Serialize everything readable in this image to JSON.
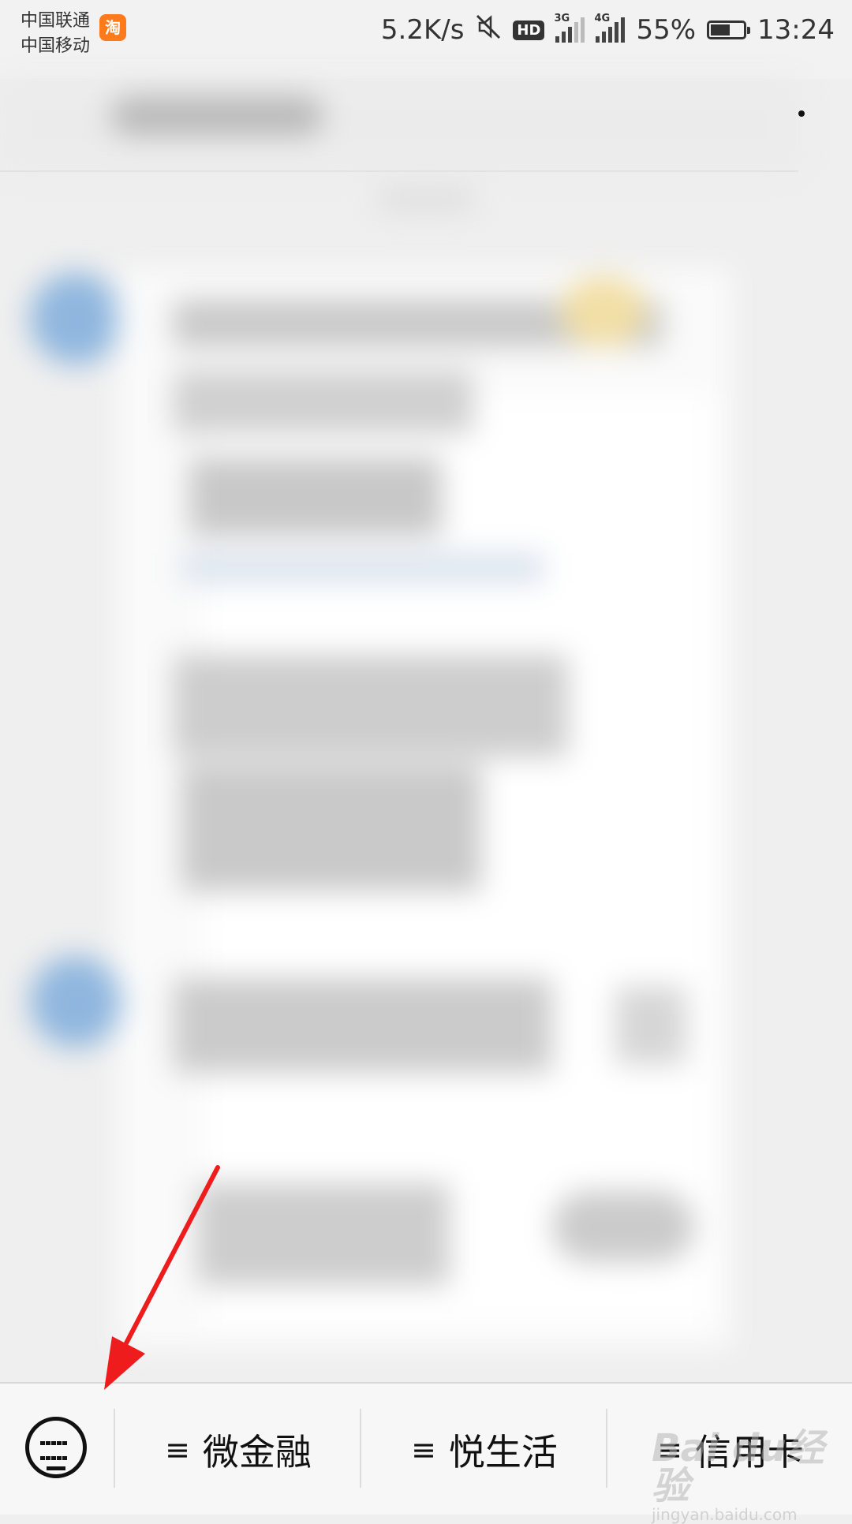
{
  "status_bar": {
    "carrier_1": "中国联通",
    "carrier_2": "中国移动",
    "app_icon_label": "淘",
    "net_speed": "5.2K/s",
    "hd": "HD",
    "signal_1_type": "3G",
    "signal_2_type": "4G",
    "battery": "55%",
    "battery_level": 0.55,
    "time": "13:24"
  },
  "bottom_menu": {
    "menu_glyph": "≡",
    "tabs": [
      {
        "label": "微金融"
      },
      {
        "label": "悦生活"
      },
      {
        "label": "信用卡"
      }
    ]
  },
  "colors": {
    "arrow": "#ee1c1c",
    "avatar": "#8fb6de"
  },
  "watermark": {
    "brand": "Bai du经验",
    "url": "jingyan.baidu.com"
  }
}
